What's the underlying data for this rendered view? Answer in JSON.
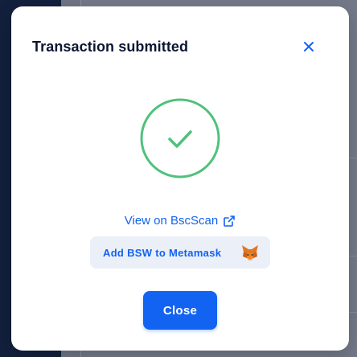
{
  "modal": {
    "title": "Transaction submitted",
    "view_link_label": "View on BscScan",
    "add_token_label": "Add BSW to Metamask",
    "close_button_label": "Close"
  },
  "icons": {
    "close": "close-icon",
    "success": "checkmark-circle-icon",
    "external_link": "external-link-icon",
    "metamask": "metamask-fox-icon"
  },
  "colors": {
    "accent": "#1263F1",
    "success": "#4FC27A",
    "title": "#0C1631",
    "token_button_bg": "#EBEFF8"
  }
}
